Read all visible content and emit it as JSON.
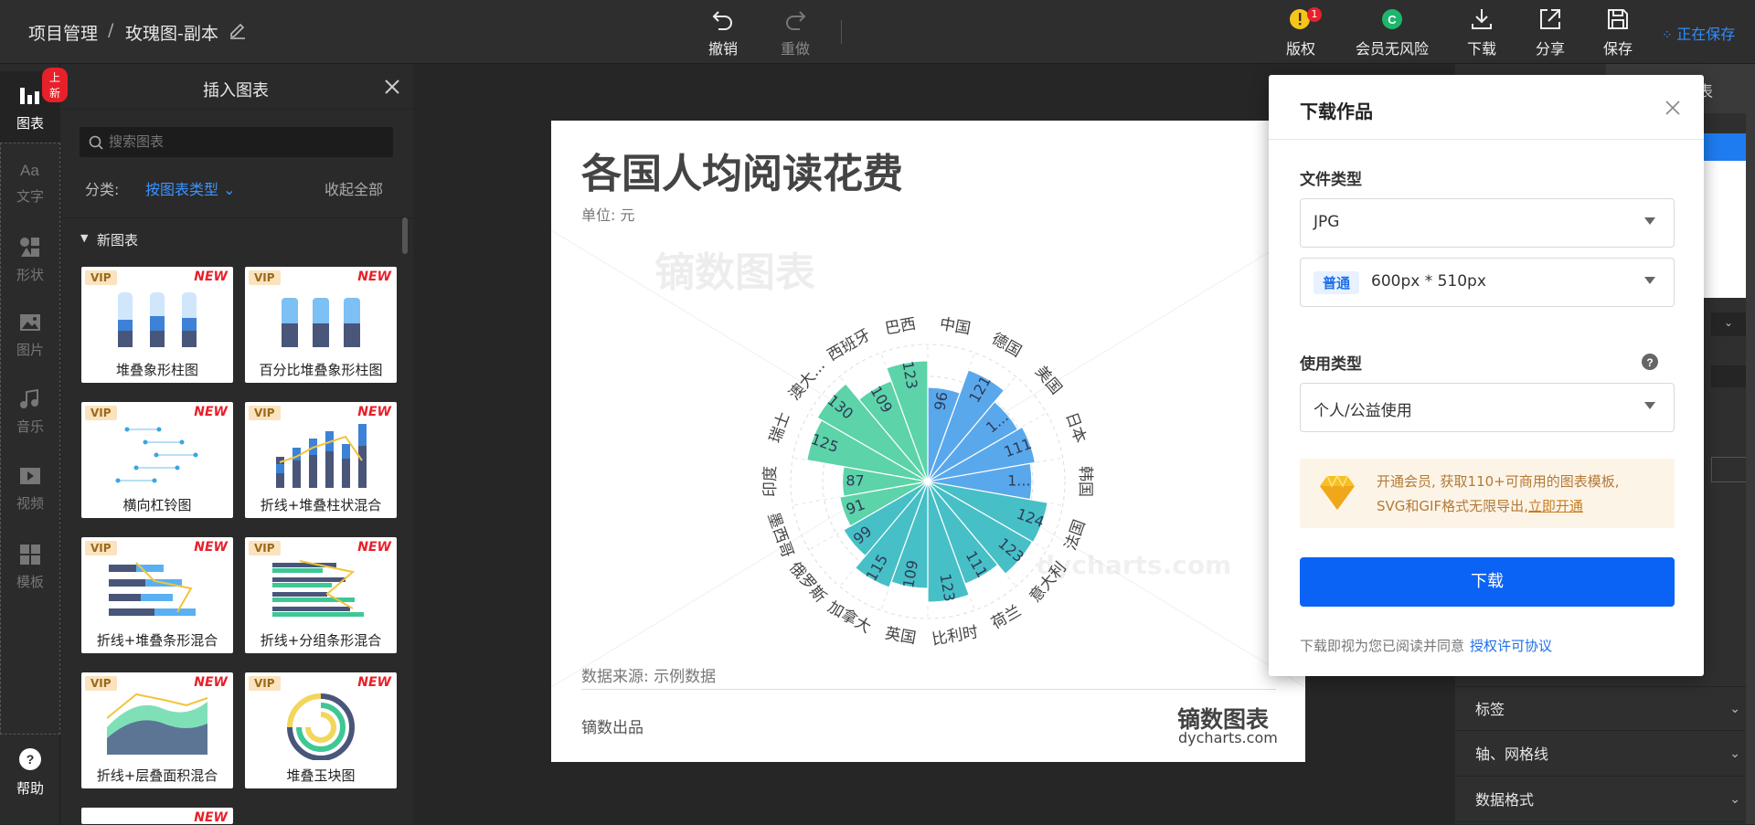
{
  "header": {
    "breadcrumb_root": "项目管理",
    "breadcrumb_sep": "/",
    "doc_title": "玫瑰图-副本",
    "undo": "撤销",
    "redo": "重做",
    "copyright": "版权",
    "copyright_badge": "1",
    "member": "会员无风险",
    "download": "下载",
    "share": "分享",
    "save": "保存",
    "saving_status": "正在保存"
  },
  "leftnav": {
    "new_badge": "上新",
    "items": [
      "图表",
      "文字",
      "形状",
      "图片",
      "音乐",
      "视频",
      "模板"
    ],
    "help": "帮助"
  },
  "panel": {
    "title": "插入图表",
    "search_placeholder": "搜索图表",
    "category_label": "分类:",
    "category_value": "按图表类型",
    "collapse_all": "收起全部",
    "section": "新图表",
    "vip": "VIP",
    "new": "NEW",
    "cards": [
      "堆叠象形柱图",
      "百分比堆叠象形柱图",
      "横向杠铃图",
      "折线+堆叠柱状混合",
      "折线+堆叠条形混合",
      "折线+分组条形混合",
      "折线+层叠面积混合",
      "堆叠玉块图"
    ]
  },
  "chart": {
    "title": "各国人均阅读花费",
    "unit": "单位: 元",
    "watermark": "镝数图表",
    "watermark2": "dycharts.com",
    "source": "数据来源: 示例数据",
    "producer": "镝数出品",
    "logo_cn": "镝数图表",
    "logo_en": "dycharts.com"
  },
  "chart_data": {
    "type": "pie",
    "subtype": "nightingale-rose",
    "categories": [
      "中国",
      "德国",
      "美国",
      "日本",
      "韩国",
      "法国",
      "意大利",
      "荷兰",
      "比利时",
      "英国",
      "加拿大",
      "俄罗斯",
      "墨西哥",
      "印度",
      "瑞士",
      "澳大...",
      "西班牙",
      "巴西"
    ],
    "values": [
      96,
      121,
      null,
      111,
      null,
      124,
      123,
      111,
      123,
      109,
      115,
      99,
      91,
      87,
      125,
      130,
      109,
      123
    ],
    "value_labels": [
      "96",
      "121",
      "1...",
      "111",
      "1...",
      "124",
      "123",
      "111",
      "123",
      "109",
      "115",
      "99",
      "91",
      "87",
      "125",
      "130",
      "109",
      "123"
    ],
    "colors": {
      "blue": "#5aa8ec",
      "teal": "#47bfc6",
      "green": "#5cd3a8"
    }
  },
  "dialog": {
    "title": "下载作品",
    "file_type_label": "文件类型",
    "file_type_value": "JPG",
    "size_tag": "普通",
    "size_value": "600px * 510px",
    "usage_label": "使用类型",
    "usage_value": "个人/公益使用",
    "promo_line1": "开通会员, 获取110+可商用的图表模板,",
    "promo_line2": "SVG和GIF格式无限导出,",
    "promo_link": "立即开通",
    "download_button": "下载",
    "agree_text": "下载即视为您已阅读并同意",
    "agree_link": "授权许可协议"
  },
  "rightpanel": {
    "rows": [
      "标签",
      "轴、网格线",
      "数据格式"
    ],
    "partial_tab": "表"
  }
}
